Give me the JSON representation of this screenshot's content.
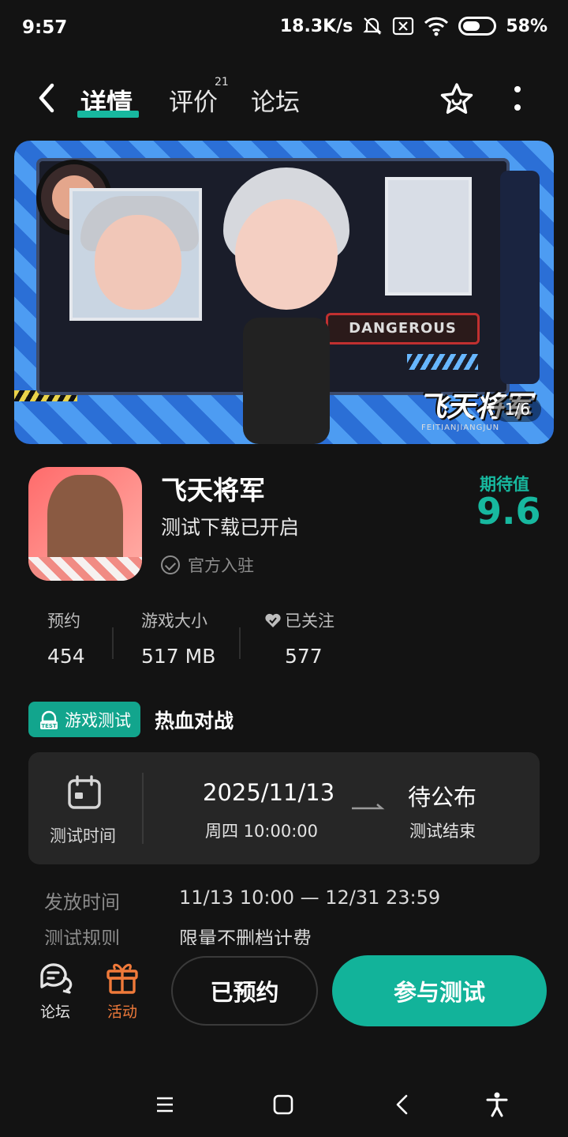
{
  "status_bar": {
    "time": "9:57",
    "network_speed": "18.3K/s",
    "battery": "58%",
    "battery_level": 0.58
  },
  "nav": {
    "tabs": [
      {
        "label": "详情",
        "active": true
      },
      {
        "label": "评价",
        "badge": "21"
      },
      {
        "label": "论坛"
      }
    ]
  },
  "banner": {
    "logo_text": "飞天将军",
    "logo_sub": "FEITIANJIANGJUN",
    "tag_text": "DANGEROUS",
    "counter": "1/6"
  },
  "app": {
    "title": "飞天将军",
    "subtitle": "测试下载已开启",
    "official": "官方入驻",
    "score_label": "期待值",
    "score": "9.6"
  },
  "stats": [
    {
      "label": "预约",
      "value": "454"
    },
    {
      "label": "游戏大小",
      "value": "517 MB"
    },
    {
      "label": "已关注",
      "value": "577"
    }
  ],
  "tags": {
    "test_tag": "游戏测试",
    "genre": "热血对战"
  },
  "test_card": {
    "label": "测试时间",
    "start_date": "2025/11/13",
    "start_time": "周四   10:00:00",
    "end_status": "待公布",
    "end_label": "测试结束"
  },
  "info": [
    {
      "label": "发放时间",
      "value": "11/13 10:00 — 12/31 23:59"
    },
    {
      "label": "测试规则",
      "value": "限量不删档计费"
    }
  ],
  "bottom_bar": {
    "forum_label": "论坛",
    "activity_label": "活动",
    "reserved_label": "已预约",
    "join_label": "参与测试"
  },
  "colors": {
    "accent": "#17b89f",
    "activity": "#f07a3a",
    "background": "#131313"
  }
}
